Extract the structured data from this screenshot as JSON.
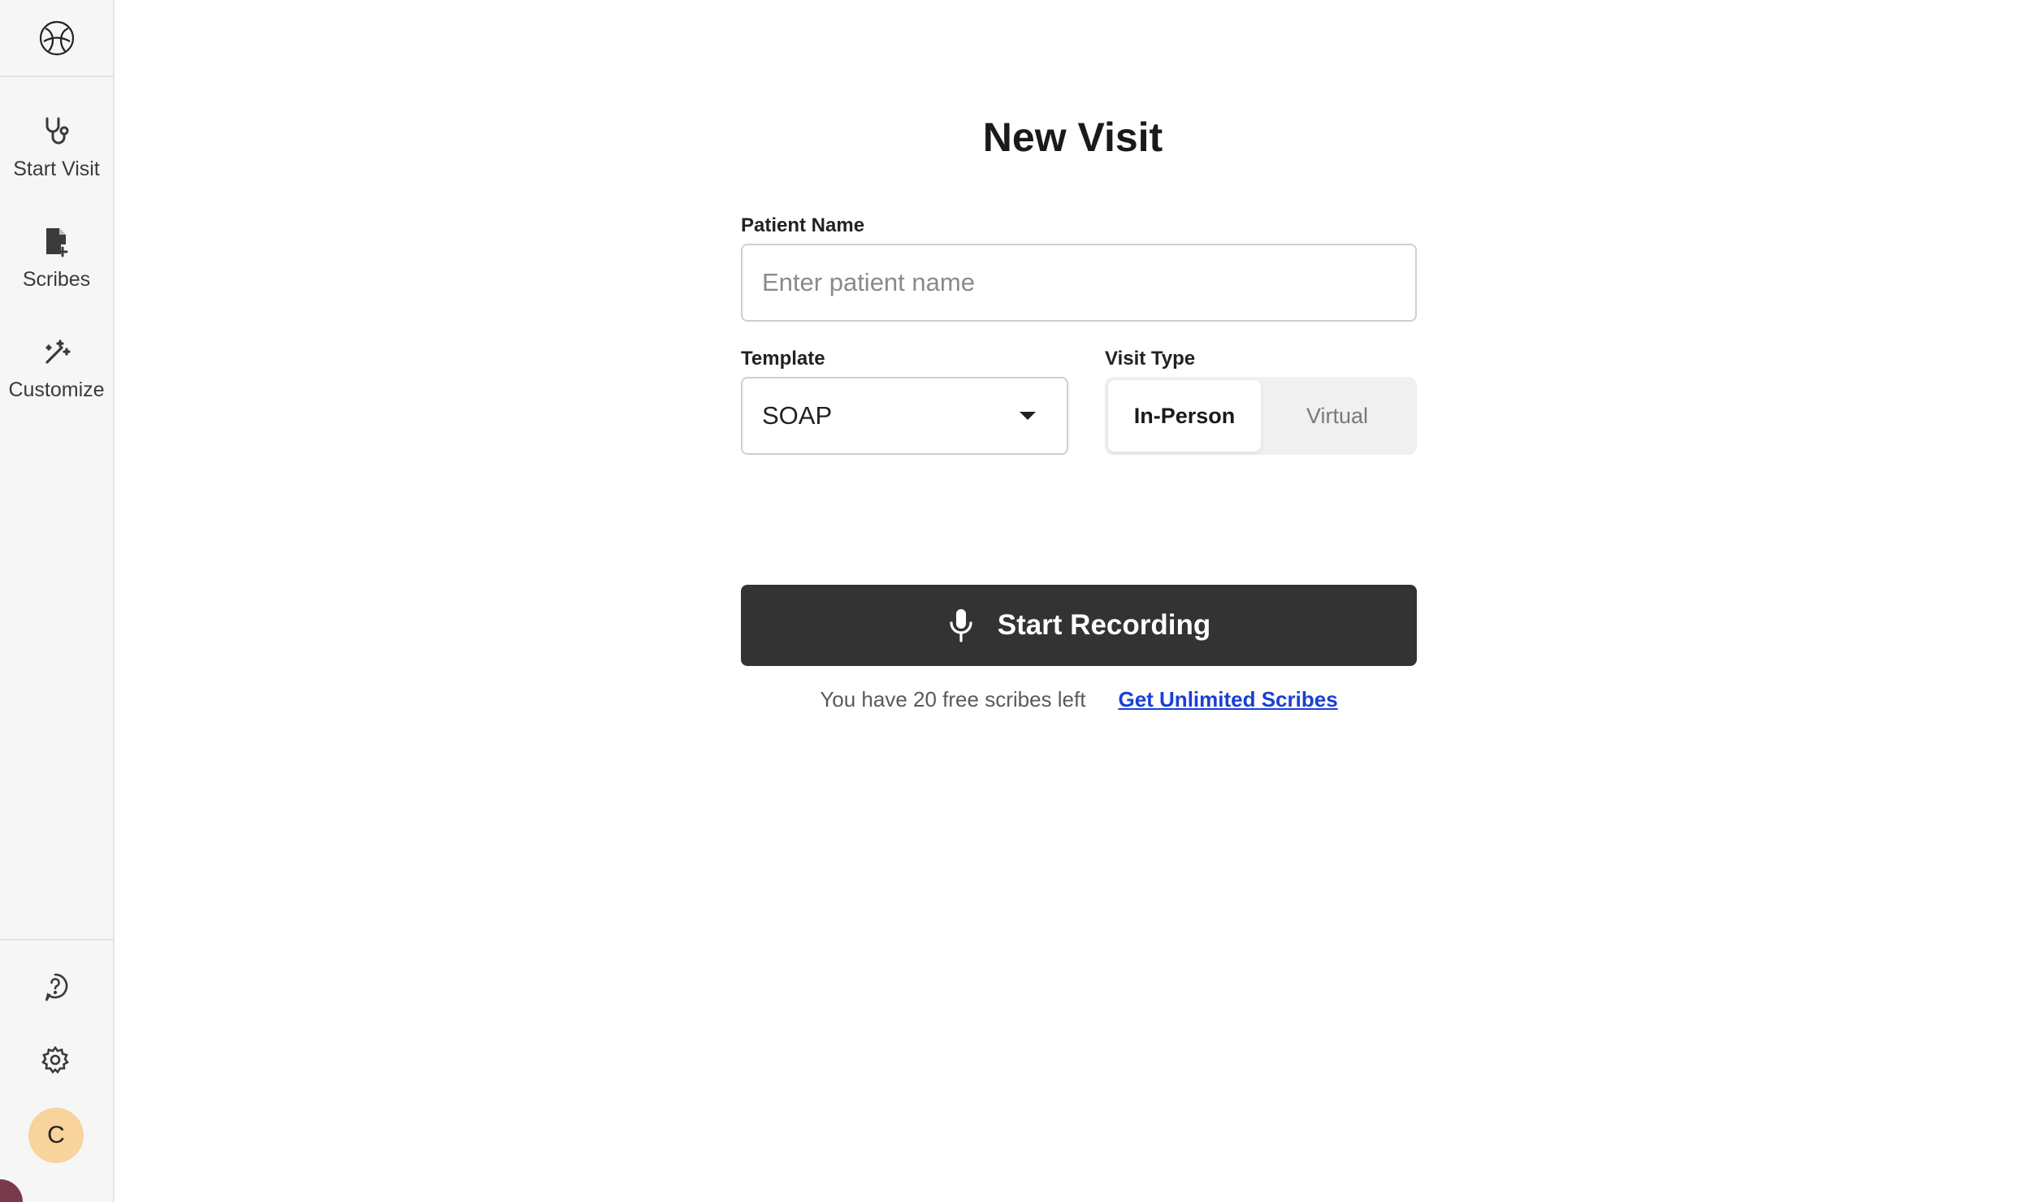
{
  "sidebar": {
    "logo_icon": "app-logo-icon",
    "items": [
      {
        "label": "Start Visit",
        "icon": "stethoscope-icon"
      },
      {
        "label": "Scribes",
        "icon": "document-icon"
      },
      {
        "label": "Customize",
        "icon": "magic-wand-icon"
      }
    ],
    "help_icon": "help-icon",
    "settings_icon": "gear-icon",
    "avatar_initial": "C"
  },
  "main": {
    "title": "New Visit",
    "patient_name": {
      "label": "Patient Name",
      "placeholder": "Enter patient name",
      "value": ""
    },
    "template": {
      "label": "Template",
      "selected": "SOAP"
    },
    "visit_type": {
      "label": "Visit Type",
      "options": [
        "In-Person",
        "Virtual"
      ],
      "selected": "In-Person"
    },
    "record_button": {
      "label": "Start Recording",
      "icon": "microphone-icon"
    },
    "remaining_text": "You have 20 free scribes left",
    "upgrade_link": "Get Unlimited Scribes"
  },
  "colors": {
    "primary_button": "#333333",
    "link": "#1a3fd6",
    "avatar_bg": "#f8d39c",
    "sidebar_bg": "#f6f6f6"
  }
}
